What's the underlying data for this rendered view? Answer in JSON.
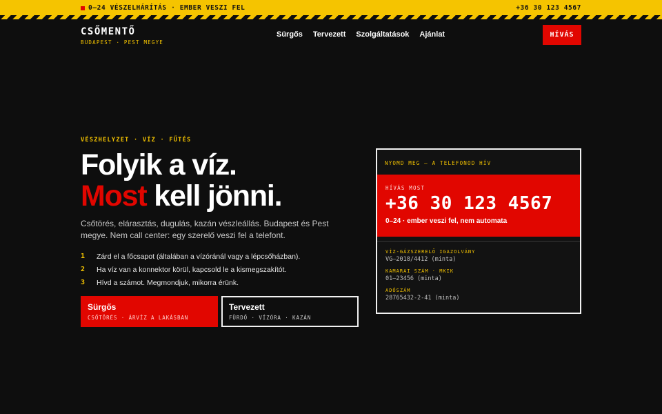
{
  "topbar": {
    "alert": "0–24 VÉSZELHÁRÍTÁS · EMBER VESZI FEL",
    "phone": "+36 30 123 4567"
  },
  "brand": {
    "name": "CSŐMENTŐ",
    "sub": "BUDAPEST · PEST MEGYE"
  },
  "nav": [
    "Sürgős",
    "Tervezett",
    "Szolgáltatások",
    "Ajánlat"
  ],
  "call_button": "HÍVÁS",
  "hero": {
    "eyebrow": "VÉSZHELYZET · VÍZ · FŰTÉS",
    "headline_line1": "Folyik a víz.",
    "headline_red": "Most",
    "headline_rest": " kell jönni.",
    "lead": "Csőtörés, elárasztás, dugulás, kazán vészleállás. Budapest és Pest megye. Nem call center: egy szerelő veszi fel a telefont.",
    "steps": [
      {
        "num": "1",
        "text": "Zárd el a főcsapot (általában a vízóránál vagy a lépcsőházban)."
      },
      {
        "num": "2",
        "text": "Ha víz van a konnektor körül, kapcsold le a kismegszakítót."
      },
      {
        "num": "3",
        "text": "Hívd a számot. Megmondjuk, mikorra érünk."
      }
    ],
    "cta_urgent": {
      "title": "Sürgős",
      "sub": "CSŐTÖRÉS · ÁRVÍZ A LAKÁSBAN"
    },
    "cta_planned": {
      "title": "Tervezett",
      "sub": "FÜRDŐ · VÍZÓRA · KAZÁN"
    }
  },
  "panel": {
    "top": "NYOMD MEG — A TELEFONOD HÍV",
    "label": "HÍVÁS MOST",
    "phone": "+36 30 123 4567",
    "note": "0–24 · ember veszi fel, nem automata",
    "info": [
      {
        "k": "VÍZ-GÁZSZERELŐ IGAZOLVÁNY",
        "v": "VG–2018/4412 (minta)"
      },
      {
        "k": "KAMARAI SZÁM · MKIK",
        "v": "01–23456 (minta)"
      },
      {
        "k": "ADÓSZÁM",
        "v": "28765432-2-41 (minta)"
      }
    ]
  },
  "colors": {
    "accent_yellow": "#f5c400",
    "accent_red": "#e10600",
    "background": "#0e0e0e"
  }
}
